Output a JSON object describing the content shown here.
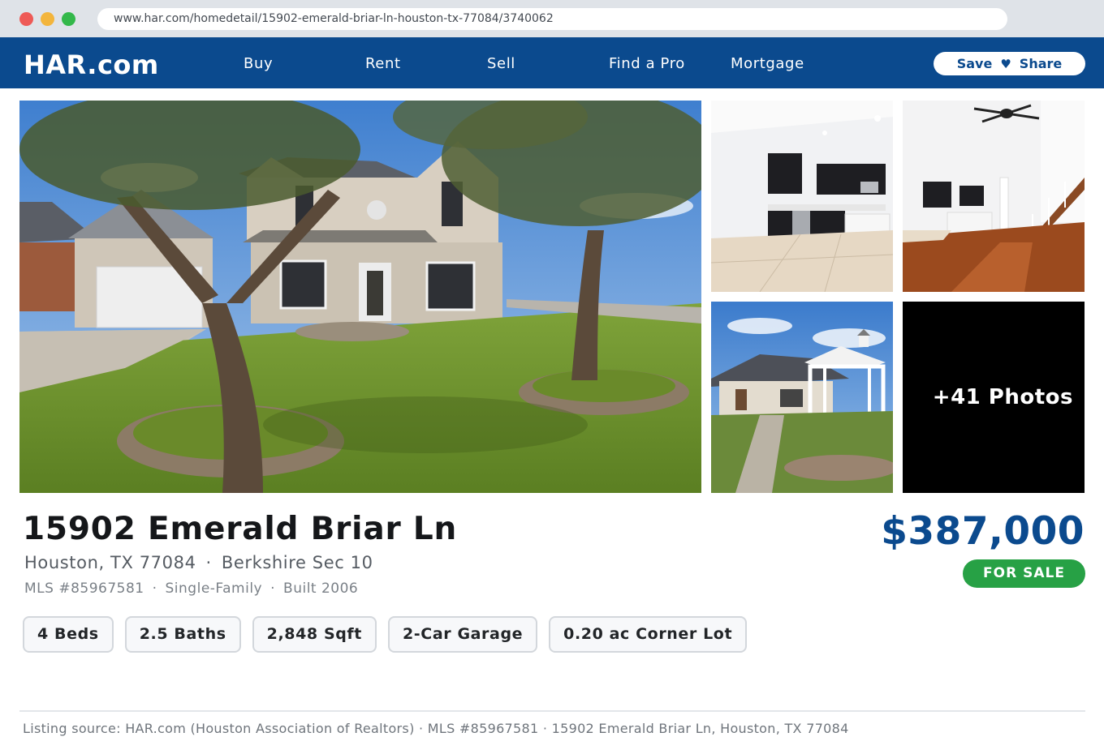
{
  "browser": {
    "url": "www.har.com/homedetail/15902-emerald-briar-ln-houston-tx-77084/3740062"
  },
  "nav": {
    "logo": "HAR.com",
    "links": [
      "Buy",
      "Rent",
      "Sell",
      "Find a Pro",
      "Mortgage"
    ],
    "save_label": "Save",
    "heart_glyph": "♥",
    "share_label": "Share"
  },
  "gallery": {
    "more_photos_label": "+41 Photos",
    "photos": [
      "house-front-exterior",
      "kitchen-interior",
      "living-room-staircase",
      "backyard-gazebo"
    ]
  },
  "listing": {
    "address": "15902 Emerald Briar Ln",
    "city_state_zip": "Houston, TX 77084",
    "subdivision": "Berkshire Sec 10",
    "mls": "MLS #85967581",
    "property_type": "Single-Family",
    "built": "Built 2006",
    "price": "$387,000",
    "status": "FOR SALE",
    "features": [
      "4 Beds",
      "2.5 Baths",
      "2,848 Sqft",
      "2-Car Garage",
      "0.20 ac Corner Lot"
    ]
  },
  "footer": {
    "source_text": "Listing source: HAR.com (Houston Association of Realtors) · MLS #85967581 · 15902 Emerald Briar Ln, Houston, TX 77084"
  },
  "colors": {
    "brand_blue": "#0b4a8e",
    "status_green": "#27a145"
  }
}
